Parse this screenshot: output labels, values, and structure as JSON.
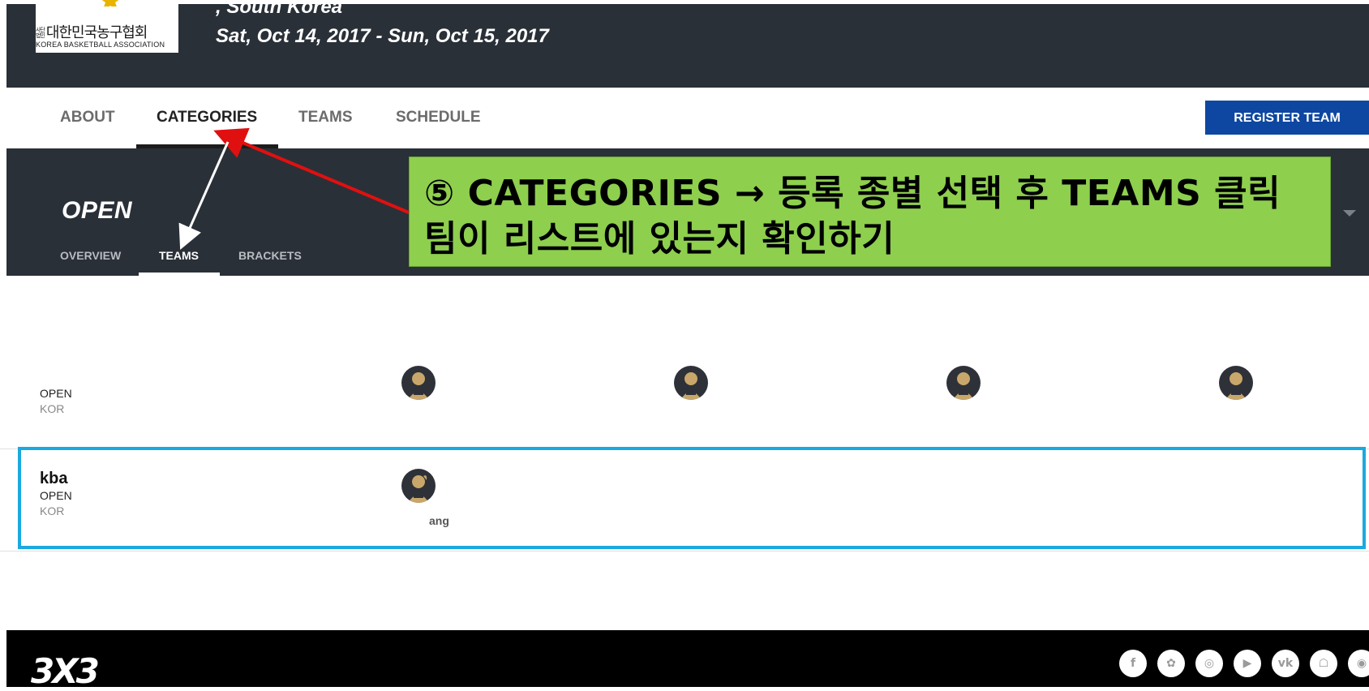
{
  "header": {
    "logo_kr": "대한민국농구협회",
    "logo_kr_small": "사단\n법인",
    "logo_en": "KOREA BASKETBALL ASSOCIATION",
    "location": ", South Korea",
    "dates": "Sat, Oct 14, 2017 - Sun, Oct 15, 2017"
  },
  "nav": {
    "items": [
      {
        "label": "ABOUT",
        "active": false
      },
      {
        "label": "CATEGORIES",
        "active": true
      },
      {
        "label": "TEAMS",
        "active": false
      },
      {
        "label": "SCHEDULE",
        "active": false
      }
    ],
    "register_label": "REGISTER TEAM"
  },
  "category": {
    "title": "OPEN",
    "tabs": [
      {
        "label": "OVERVIEW",
        "active": false
      },
      {
        "label": "TEAMS",
        "active": true
      },
      {
        "label": "BRACKETS",
        "active": false
      }
    ]
  },
  "annotation": {
    "line1": "⑤ CATEGORIES → 등록 종별 선택 후 TEAMS 클릭",
    "line2": "팀이 리스트에 있는지 확인하기"
  },
  "teams": [
    {
      "name": "",
      "category": "OPEN",
      "country": "KOR",
      "players": [
        "",
        "",
        "",
        ""
      ]
    },
    {
      "name": "kba",
      "category": "OPEN",
      "country": "KOR",
      "players": [
        "ang"
      ]
    }
  ],
  "footer": {
    "logo": "3X3",
    "social_icons": [
      "facebook-icon",
      "twitter-icon",
      "instagram-icon",
      "youtube-icon",
      "vk-icon",
      "snapchat-icon",
      "weibo-icon"
    ]
  },
  "colors": {
    "header_bg": "#2a3038",
    "register_bg": "#0d47a1",
    "annotation_bg": "#8ecf4e",
    "highlight_border": "#1aa9e0",
    "arrow_red": "#e01010"
  }
}
